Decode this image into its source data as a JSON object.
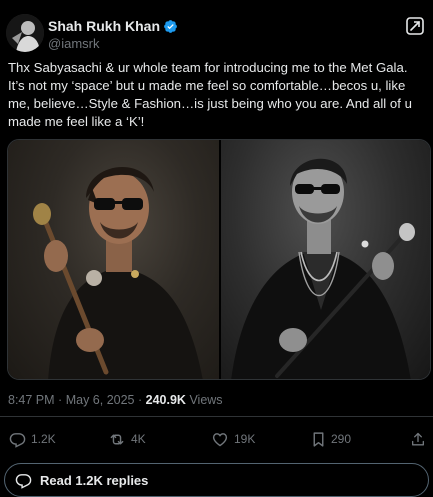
{
  "author": {
    "display_name": "Shah Rukh Khan",
    "handle": "@iamsrk",
    "verified": true,
    "verified_color": "#1d9bf0"
  },
  "tweet": {
    "text": "Thx Sabyasachi & ur whole team for introducing me to the Met Gala. It’s not  my ‘space’ but u made me feel so comfortable…becos u, like me, believe…Style & Fashion…is just being who you are. And all of u made me feel like a ‘K’!"
  },
  "media": {
    "photos": [
      {
        "icon": "photo-srk-color"
      },
      {
        "icon": "photo-srk-bw"
      }
    ]
  },
  "meta": {
    "time": "8:47 PM",
    "separator": "·",
    "date": "May 6, 2025",
    "separator2": "·",
    "views_count": "240.9K",
    "views_label": "Views"
  },
  "actions": {
    "replies": "1.2K",
    "reposts": "4K",
    "likes": "19K",
    "bookmarks": "290"
  },
  "read_replies": {
    "label": "Read 1.2K replies"
  },
  "colors": {
    "background": "#000000",
    "text_primary": "#e7e9ea",
    "text_secondary": "#71767b",
    "border": "#2f3336",
    "accent": "#1d9bf0"
  }
}
